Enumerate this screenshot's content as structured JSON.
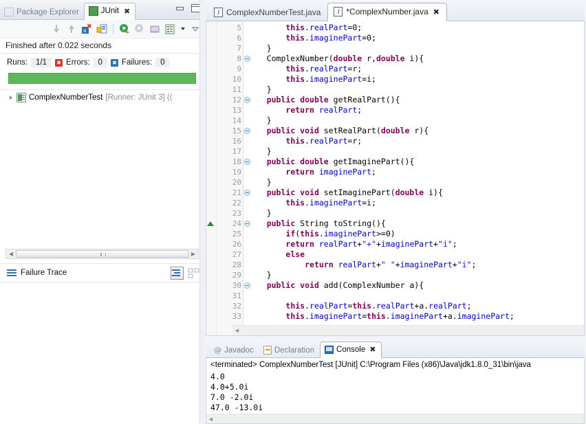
{
  "junit_view": {
    "tabs": [
      {
        "label": "Package Explorer",
        "icon": "package-explorer-icon",
        "active": false
      },
      {
        "label": "JUnit",
        "icon": "junit-icon",
        "active": true
      }
    ],
    "close_glyph": "✖",
    "window_buttons": [
      {
        "name": "minimize-view-button",
        "label": ""
      },
      {
        "name": "maximize-view-button",
        "label": ""
      }
    ],
    "toolbar": [
      {
        "name": "next-failed-test-button",
        "title": "Next Failed Test"
      },
      {
        "name": "previous-failed-test-button",
        "title": "Previous Failed Test"
      },
      {
        "name": "show-failures-only-button",
        "title": "Show Failures Only"
      },
      {
        "name": "lock-scroll-button",
        "title": "Scroll Lock"
      },
      {
        "name": "rerun-test-button",
        "title": "Rerun Test"
      },
      {
        "name": "rerun-failed-tests-button",
        "title": "Rerun Test - Failures First"
      },
      {
        "name": "stop-test-button",
        "title": "Stop JUnit Test Run"
      },
      {
        "name": "test-run-history-button",
        "title": "Test Run History"
      },
      {
        "name": "view-menu-dropdown",
        "title": "View Menu"
      },
      {
        "name": "view-minimize-chevron",
        "title": "Minimize"
      }
    ],
    "status_text": "Finished after 0.022 seconds",
    "counters": [
      {
        "name": "runs-counter",
        "label": "Runs:",
        "value": "1/1",
        "icon": null
      },
      {
        "name": "errors-counter",
        "label": "Errors:",
        "value": "0",
        "icon": "error-icon"
      },
      {
        "name": "failures-counter",
        "label": "Failures:",
        "value": "0",
        "icon": "failure-icon"
      }
    ],
    "progress": {
      "percent": 100,
      "color": "#5cb85c"
    },
    "tree": [
      {
        "name": "ComplexNumberTest",
        "meta": "[Runner: JUnit 3] ((",
        "expanded": false
      }
    ],
    "failure_trace": {
      "label": "Failure Trace",
      "buttons": [
        {
          "name": "filter-stack-trace-button"
        },
        {
          "name": "compare-result-button"
        }
      ],
      "content": ""
    },
    "hscroll": {
      "left_arrow": "◀",
      "right_arrow": "▶"
    }
  },
  "editor": {
    "tabs": [
      {
        "label": "ComplexNumberTest.java",
        "icon": "java-file-icon",
        "active": false,
        "dirty": false
      },
      {
        "label": "*ComplexNumber.java",
        "icon": "java-file-icon",
        "active": true,
        "dirty": true
      }
    ],
    "close_glyph": "✖",
    "first_line": 5,
    "lines": [
      {
        "n": 5,
        "fold": false,
        "marker": null,
        "tokens": [
          {
            "t": "        ",
            "c": "pln"
          },
          {
            "t": "this",
            "c": "kw"
          },
          {
            "t": ".",
            "c": "pln"
          },
          {
            "t": "realPart",
            "c": "fld"
          },
          {
            "t": "=0;",
            "c": "pln"
          }
        ]
      },
      {
        "n": 6,
        "fold": false,
        "marker": null,
        "tokens": [
          {
            "t": "        ",
            "c": "pln"
          },
          {
            "t": "this",
            "c": "kw"
          },
          {
            "t": ".",
            "c": "pln"
          },
          {
            "t": "imaginePart",
            "c": "fld"
          },
          {
            "t": "=0;",
            "c": "pln"
          }
        ]
      },
      {
        "n": 7,
        "fold": false,
        "marker": null,
        "tokens": [
          {
            "t": "    }",
            "c": "pln"
          }
        ]
      },
      {
        "n": 8,
        "fold": true,
        "marker": null,
        "tokens": [
          {
            "t": "    ComplexNumber(",
            "c": "pln"
          },
          {
            "t": "double",
            "c": "kw"
          },
          {
            "t": " r,",
            "c": "pln"
          },
          {
            "t": "double",
            "c": "kw"
          },
          {
            "t": " i){",
            "c": "pln"
          }
        ]
      },
      {
        "n": 9,
        "fold": false,
        "marker": null,
        "tokens": [
          {
            "t": "        ",
            "c": "pln"
          },
          {
            "t": "this",
            "c": "kw"
          },
          {
            "t": ".",
            "c": "pln"
          },
          {
            "t": "realPart",
            "c": "fld"
          },
          {
            "t": "=r;",
            "c": "pln"
          }
        ]
      },
      {
        "n": 10,
        "fold": false,
        "marker": null,
        "tokens": [
          {
            "t": "        ",
            "c": "pln"
          },
          {
            "t": "this",
            "c": "kw"
          },
          {
            "t": ".",
            "c": "pln"
          },
          {
            "t": "imaginePart",
            "c": "fld"
          },
          {
            "t": "=i;",
            "c": "pln"
          }
        ]
      },
      {
        "n": 11,
        "fold": false,
        "marker": null,
        "tokens": [
          {
            "t": "    }",
            "c": "pln"
          }
        ]
      },
      {
        "n": 12,
        "fold": true,
        "marker": null,
        "tokens": [
          {
            "t": "    ",
            "c": "pln"
          },
          {
            "t": "public double",
            "c": "kw"
          },
          {
            "t": " getRealPart(){",
            "c": "pln"
          }
        ]
      },
      {
        "n": 13,
        "fold": false,
        "marker": null,
        "tokens": [
          {
            "t": "        ",
            "c": "pln"
          },
          {
            "t": "return",
            "c": "kw"
          },
          {
            "t": " ",
            "c": "pln"
          },
          {
            "t": "realPart",
            "c": "fld"
          },
          {
            "t": ";",
            "c": "pln"
          }
        ]
      },
      {
        "n": 14,
        "fold": false,
        "marker": null,
        "tokens": [
          {
            "t": "    }",
            "c": "pln"
          }
        ]
      },
      {
        "n": 15,
        "fold": true,
        "marker": null,
        "tokens": [
          {
            "t": "    ",
            "c": "pln"
          },
          {
            "t": "public void",
            "c": "kw"
          },
          {
            "t": " setRealPart(",
            "c": "pln"
          },
          {
            "t": "double",
            "c": "kw"
          },
          {
            "t": " r){",
            "c": "pln"
          }
        ]
      },
      {
        "n": 16,
        "fold": false,
        "marker": null,
        "tokens": [
          {
            "t": "        ",
            "c": "pln"
          },
          {
            "t": "this",
            "c": "kw"
          },
          {
            "t": ".",
            "c": "pln"
          },
          {
            "t": "realPart",
            "c": "fld"
          },
          {
            "t": "=r;",
            "c": "pln"
          }
        ]
      },
      {
        "n": 17,
        "fold": false,
        "marker": null,
        "tokens": [
          {
            "t": "    }",
            "c": "pln"
          }
        ]
      },
      {
        "n": 18,
        "fold": true,
        "marker": null,
        "tokens": [
          {
            "t": "    ",
            "c": "pln"
          },
          {
            "t": "public double",
            "c": "kw"
          },
          {
            "t": " getImaginePart(){",
            "c": "pln"
          }
        ]
      },
      {
        "n": 19,
        "fold": false,
        "marker": null,
        "tokens": [
          {
            "t": "        ",
            "c": "pln"
          },
          {
            "t": "return",
            "c": "kw"
          },
          {
            "t": " ",
            "c": "pln"
          },
          {
            "t": "imaginePart",
            "c": "fld"
          },
          {
            "t": ";",
            "c": "pln"
          }
        ]
      },
      {
        "n": 20,
        "fold": false,
        "marker": null,
        "tokens": [
          {
            "t": "    }",
            "c": "pln"
          }
        ]
      },
      {
        "n": 21,
        "fold": true,
        "marker": null,
        "tokens": [
          {
            "t": "    ",
            "c": "pln"
          },
          {
            "t": "public void",
            "c": "kw"
          },
          {
            "t": " setImaginePart(",
            "c": "pln"
          },
          {
            "t": "double",
            "c": "kw"
          },
          {
            "t": " i){",
            "c": "pln"
          }
        ]
      },
      {
        "n": 22,
        "fold": false,
        "marker": null,
        "tokens": [
          {
            "t": "        ",
            "c": "pln"
          },
          {
            "t": "this",
            "c": "kw"
          },
          {
            "t": ".",
            "c": "pln"
          },
          {
            "t": "imaginePart",
            "c": "fld"
          },
          {
            "t": "=i;",
            "c": "pln"
          }
        ]
      },
      {
        "n": 23,
        "fold": false,
        "marker": null,
        "tokens": [
          {
            "t": "    }",
            "c": "pln"
          }
        ]
      },
      {
        "n": 24,
        "fold": true,
        "marker": "override-method-marker",
        "tokens": [
          {
            "t": "    ",
            "c": "pln"
          },
          {
            "t": "public",
            "c": "kw"
          },
          {
            "t": " String toString(){",
            "c": "pln"
          }
        ]
      },
      {
        "n": 25,
        "fold": false,
        "marker": null,
        "tokens": [
          {
            "t": "        ",
            "c": "pln"
          },
          {
            "t": "if",
            "c": "kw"
          },
          {
            "t": "(",
            "c": "pln"
          },
          {
            "t": "this",
            "c": "kw"
          },
          {
            "t": ".",
            "c": "pln"
          },
          {
            "t": "imaginePart",
            "c": "fld"
          },
          {
            "t": ">=0)",
            "c": "pln"
          }
        ]
      },
      {
        "n": 26,
        "fold": false,
        "marker": null,
        "tokens": [
          {
            "t": "        ",
            "c": "pln"
          },
          {
            "t": "return",
            "c": "kw"
          },
          {
            "t": " ",
            "c": "pln"
          },
          {
            "t": "realPart",
            "c": "fld"
          },
          {
            "t": "+",
            "c": "pln"
          },
          {
            "t": "\"+\"",
            "c": "str"
          },
          {
            "t": "+",
            "c": "pln"
          },
          {
            "t": "imaginePart",
            "c": "fld"
          },
          {
            "t": "+",
            "c": "pln"
          },
          {
            "t": "\"i\"",
            "c": "str"
          },
          {
            "t": ";",
            "c": "pln"
          }
        ]
      },
      {
        "n": 27,
        "fold": false,
        "marker": null,
        "tokens": [
          {
            "t": "        ",
            "c": "pln"
          },
          {
            "t": "else",
            "c": "kw"
          }
        ]
      },
      {
        "n": 28,
        "fold": false,
        "marker": null,
        "tokens": [
          {
            "t": "            ",
            "c": "pln"
          },
          {
            "t": "return",
            "c": "kw"
          },
          {
            "t": " ",
            "c": "pln"
          },
          {
            "t": "realPart",
            "c": "fld"
          },
          {
            "t": "+",
            "c": "pln"
          },
          {
            "t": "\" \"",
            "c": "str"
          },
          {
            "t": "+",
            "c": "pln"
          },
          {
            "t": "imaginePart",
            "c": "fld"
          },
          {
            "t": "+",
            "c": "pln"
          },
          {
            "t": "\"i\"",
            "c": "str"
          },
          {
            "t": ";",
            "c": "pln"
          }
        ]
      },
      {
        "n": 29,
        "fold": false,
        "marker": null,
        "tokens": [
          {
            "t": "    }",
            "c": "pln"
          }
        ]
      },
      {
        "n": 30,
        "fold": true,
        "marker": null,
        "tokens": [
          {
            "t": "    ",
            "c": "pln"
          },
          {
            "t": "public void",
            "c": "kw"
          },
          {
            "t": " add(ComplexNumber a){",
            "c": "pln"
          }
        ]
      },
      {
        "n": 31,
        "fold": false,
        "marker": null,
        "tokens": [
          {
            "t": "",
            "c": "pln"
          }
        ]
      },
      {
        "n": 32,
        "fold": false,
        "marker": null,
        "tokens": [
          {
            "t": "        ",
            "c": "pln"
          },
          {
            "t": "this",
            "c": "kw"
          },
          {
            "t": ".",
            "c": "pln"
          },
          {
            "t": "realPart",
            "c": "fld"
          },
          {
            "t": "=",
            "c": "pln"
          },
          {
            "t": "this",
            "c": "kw"
          },
          {
            "t": ".",
            "c": "pln"
          },
          {
            "t": "realPart",
            "c": "fld"
          },
          {
            "t": "+a.",
            "c": "pln"
          },
          {
            "t": "realPart",
            "c": "fld"
          },
          {
            "t": ";",
            "c": "pln"
          }
        ]
      },
      {
        "n": 33,
        "fold": false,
        "marker": null,
        "tokens": [
          {
            "t": "        ",
            "c": "pln"
          },
          {
            "t": "this",
            "c": "kw"
          },
          {
            "t": ".",
            "c": "pln"
          },
          {
            "t": "imaginePart",
            "c": "fld"
          },
          {
            "t": "=",
            "c": "pln"
          },
          {
            "t": "this",
            "c": "kw"
          },
          {
            "t": ".",
            "c": "pln"
          },
          {
            "t": "imaginePart",
            "c": "fld"
          },
          {
            "t": "+a.",
            "c": "pln"
          },
          {
            "t": "imaginePart",
            "c": "fld"
          },
          {
            "t": ";",
            "c": "pln"
          }
        ]
      }
    ],
    "hscroll": {
      "left_arrow": "◀",
      "right_arrow": "▶"
    }
  },
  "console_view": {
    "tabs": [
      {
        "label": "Javadoc",
        "icon": "javadoc-icon",
        "active": false
      },
      {
        "label": "Declaration",
        "icon": "declaration-icon",
        "active": false
      },
      {
        "label": "Console",
        "icon": "console-icon",
        "active": true
      }
    ],
    "close_glyph": "✖",
    "process_line": "<terminated> ComplexNumberTest [JUnit] C:\\Program Files (x86)\\Java\\jdk1.8.0_31\\bin\\java",
    "output": "4.0\n4.0+5.0i\n7.0 -2.0i\n47.0 -13.0i",
    "hscroll": {
      "left_arrow": "◀"
    }
  },
  "colors": {
    "accent_blue": "#2f6fb5",
    "success_green": "#5cb85c",
    "error_red": "#d9342b",
    "keyword_purple": "#7f0055",
    "field_blue": "#0000c0",
    "string_blue": "#2a00ff",
    "tab_active_bg": "#ffffff",
    "chrome_bg": "#f2f3f7"
  }
}
